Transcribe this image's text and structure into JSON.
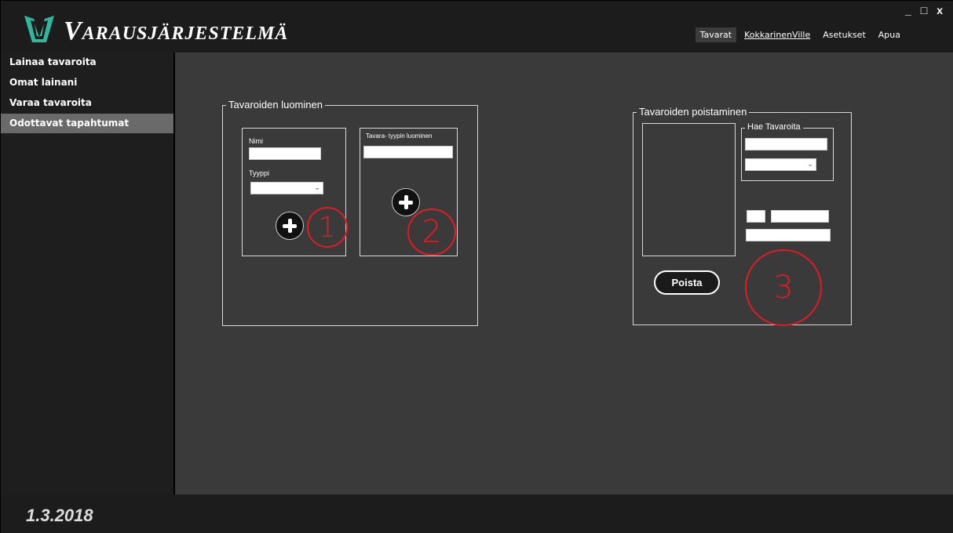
{
  "header": {
    "app_title": "Varausjärjestelmä",
    "window_controls": {
      "minimize": "_",
      "maximize": "□",
      "close": "x"
    },
    "nav": [
      {
        "label": "Tavarat",
        "active": true
      },
      {
        "label": "KokkarinenVille",
        "active": false
      },
      {
        "label": "Asetukset",
        "active": false
      },
      {
        "label": "Apua",
        "active": false
      }
    ]
  },
  "sidebar": {
    "items": [
      {
        "label": "Lainaa tavaroita",
        "active": false
      },
      {
        "label": "Omat lainani",
        "active": false
      },
      {
        "label": "Varaa tavaroita",
        "active": false
      },
      {
        "label": "Odottavat tapahtumat",
        "active": true
      }
    ]
  },
  "create_group": {
    "title": "Tavaroiden luominen",
    "item_panel": {
      "name_label": "Nimi",
      "name_value": "",
      "type_label": "Tyyppi",
      "type_value": "",
      "add_icon": "plus-circle-icon",
      "annotation": "1"
    },
    "type_panel": {
      "title": "Tavara- tyypin luominen",
      "type_name_value": "",
      "add_icon": "plus-circle-icon",
      "annotation": "2"
    }
  },
  "delete_group": {
    "title": "Tavaroiden poistaminen",
    "search": {
      "title": "Hae Tavaroita",
      "query_value": "",
      "filter_value": ""
    },
    "delete_button": "Poista",
    "annotation": "3"
  },
  "status": {
    "date": "1.3.2018"
  },
  "colors": {
    "background": "#3a3a3a",
    "sidebar": "#1e1e1e",
    "active_item": "#6a6a6a",
    "annotation": "#e21b23"
  }
}
